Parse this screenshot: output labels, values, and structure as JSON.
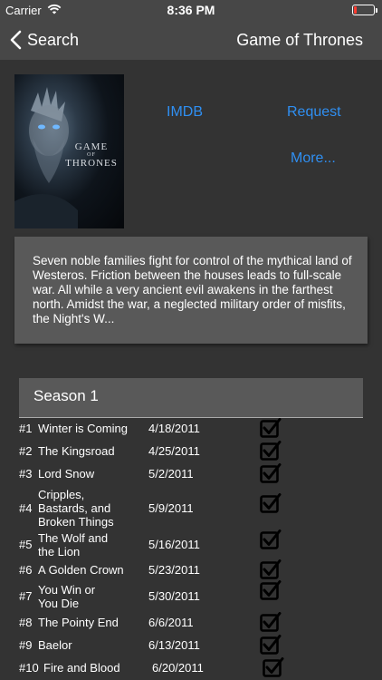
{
  "status_bar": {
    "carrier": "Carrier",
    "time": "8:36 PM"
  },
  "nav": {
    "back_label": "Search",
    "title": "Game of Thrones"
  },
  "poster": {
    "title_line1": "GAME",
    "title_line2": "OF",
    "title_line3": "THRONES"
  },
  "links": {
    "imdb": "IMDB",
    "request": "Request",
    "more": "More..."
  },
  "summary": "Seven noble families fight for control of the mythical land of Westeros. Friction between the houses leads to full-scale war. All while a very ancient evil awakens in the farthest north. Amidst the war, a neglected military order of misfits, the Night's W...",
  "season": {
    "title": "Season 1",
    "episodes": [
      {
        "num": "#1",
        "name": "Winter is Coming",
        "date": "4/18/2011",
        "watched": true
      },
      {
        "num": "#2",
        "name": "The Kingsroad",
        "date": "4/25/2011",
        "watched": true
      },
      {
        "num": "#3",
        "name": "Lord Snow",
        "date": "5/2/2011",
        "watched": true
      },
      {
        "num": "#4",
        "name": "Cripples, Bastards, and Broken Things",
        "date": "5/9/2011",
        "watched": true
      },
      {
        "num": "#5",
        "name": "The Wolf and the Lion",
        "date": "5/16/2011",
        "watched": true
      },
      {
        "num": "#6",
        "name": "A Golden Crown",
        "date": "5/23/2011",
        "watched": true
      },
      {
        "num": "#7",
        "name": "You Win or You Die",
        "date": "5/30/2011",
        "watched": true
      },
      {
        "num": "#8",
        "name": "The Pointy End",
        "date": "6/6/2011",
        "watched": true
      },
      {
        "num": "#9",
        "name": "Baelor",
        "date": "6/13/2011",
        "watched": true
      },
      {
        "num": "#10",
        "name": "Fire and Blood",
        "date": "6/20/2011",
        "watched": true
      }
    ]
  },
  "colors": {
    "background": "#333333",
    "bar": "#474747",
    "card": "#595959",
    "link": "#2f8ff2"
  }
}
